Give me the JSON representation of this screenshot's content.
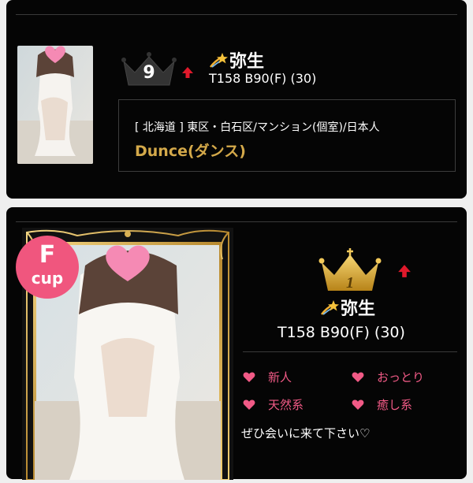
{
  "entries": [
    {
      "rank": "9",
      "trend": "up",
      "name": "弥生",
      "stats": "T158 B90(F) (30)",
      "location": "[ 北海道 ] 東区・白石区/マンション(個室)/日本人",
      "shop": "Dunce(ダンス)"
    },
    {
      "rank": "1",
      "trend": "up",
      "cup_letter": "F",
      "cup_label": "cup",
      "name": "弥生",
      "stats": "T158 B90(F) (30)",
      "tags": [
        "新人",
        "おっとり",
        "天然系",
        "癒し系"
      ],
      "message": "ぜひ会いに来て下さい♡"
    }
  ],
  "colors": {
    "accent_gold": "#d4a94a",
    "tag_pink": "#f15a86",
    "badge_pink": "#f0567e",
    "arrow_red": "#e0192b"
  },
  "icons": [
    "crown-icon",
    "up-arrow-icon",
    "shooting-star-icon",
    "heart-icon"
  ]
}
